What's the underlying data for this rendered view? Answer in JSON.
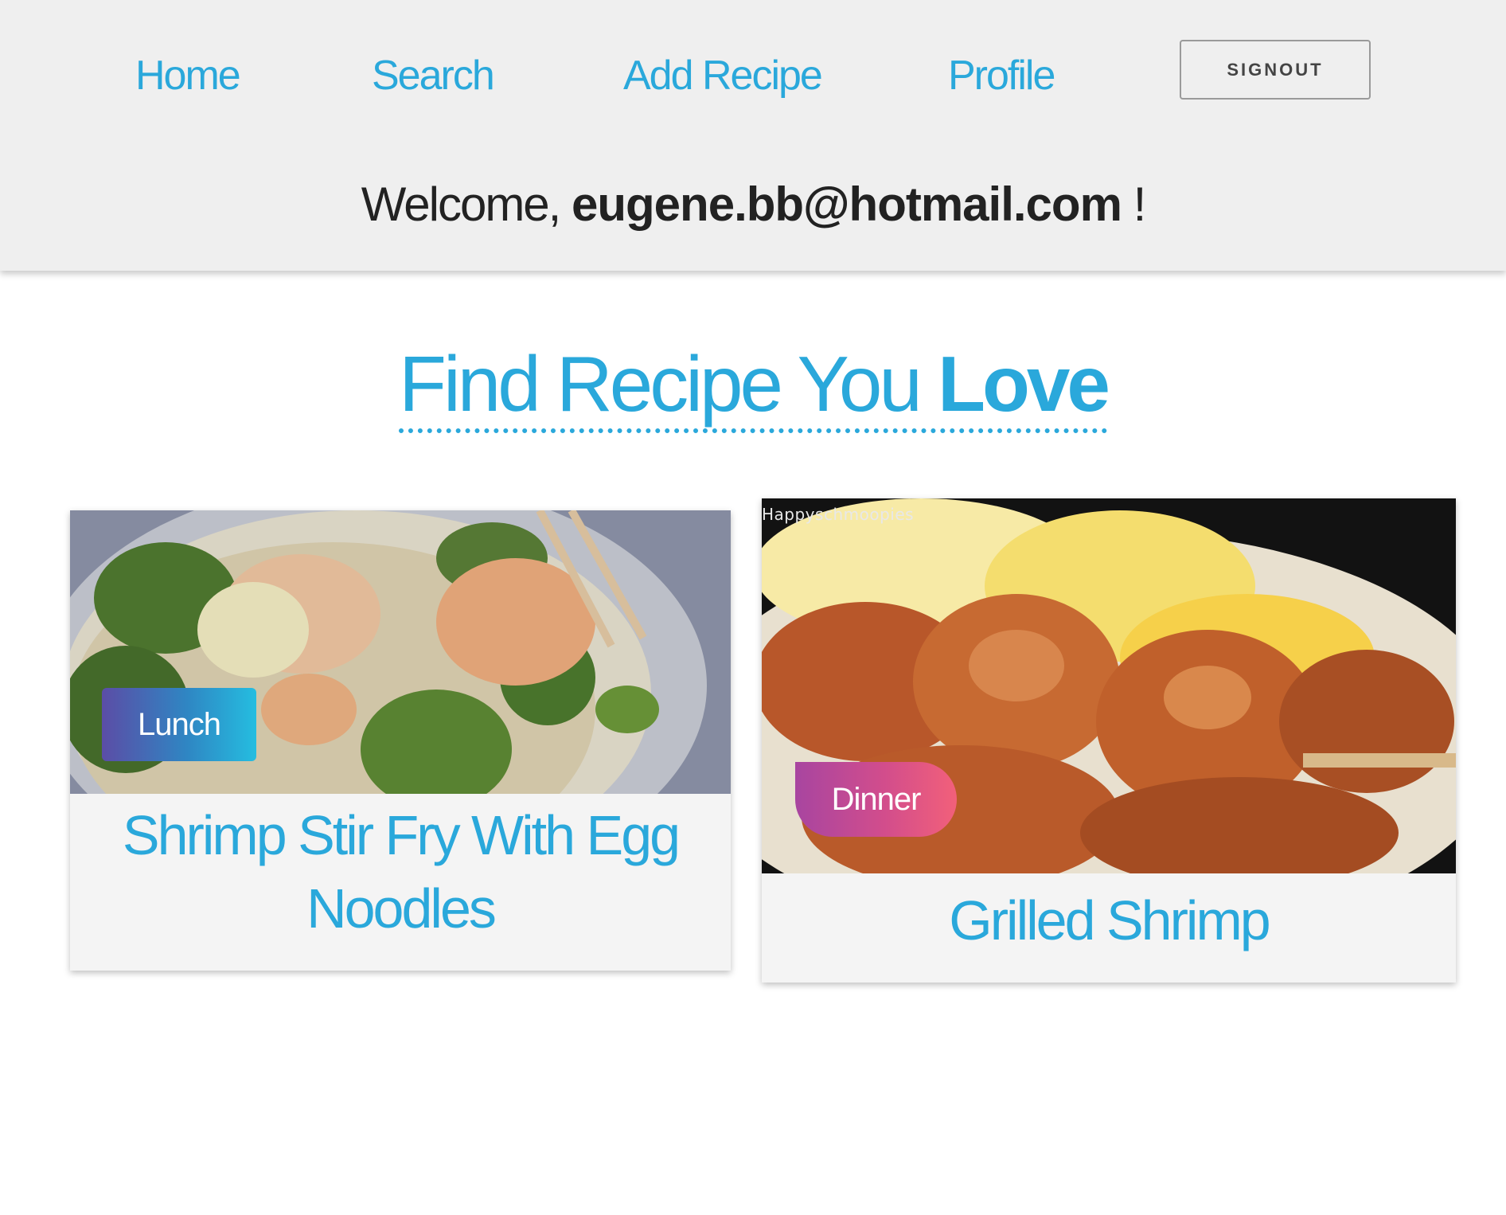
{
  "nav": {
    "home": "Home",
    "search": "Search",
    "add_recipe": "Add Recipe",
    "profile": "Profile",
    "signout": "SIGNOUT"
  },
  "welcome": {
    "prefix": "Welcome,",
    "email": "eugene.bb@hotmail.com",
    "suffix": "!"
  },
  "hero": {
    "light": "Find Recipe You",
    "bold": "Love"
  },
  "recipes": [
    {
      "title": "Shrimp Stir Fry With Egg Noodles",
      "category": "Lunch"
    },
    {
      "title": "Grilled Shrimp",
      "category": "Dinner",
      "image_watermark": "Happyschmoopies"
    }
  ],
  "colors": {
    "accent": "#2aa8db",
    "header_bg": "#efefef",
    "lunch_badge": [
      "#5b4da6",
      "#25bde0"
    ],
    "dinner_badge": [
      "#a845a0",
      "#f2607a"
    ]
  }
}
